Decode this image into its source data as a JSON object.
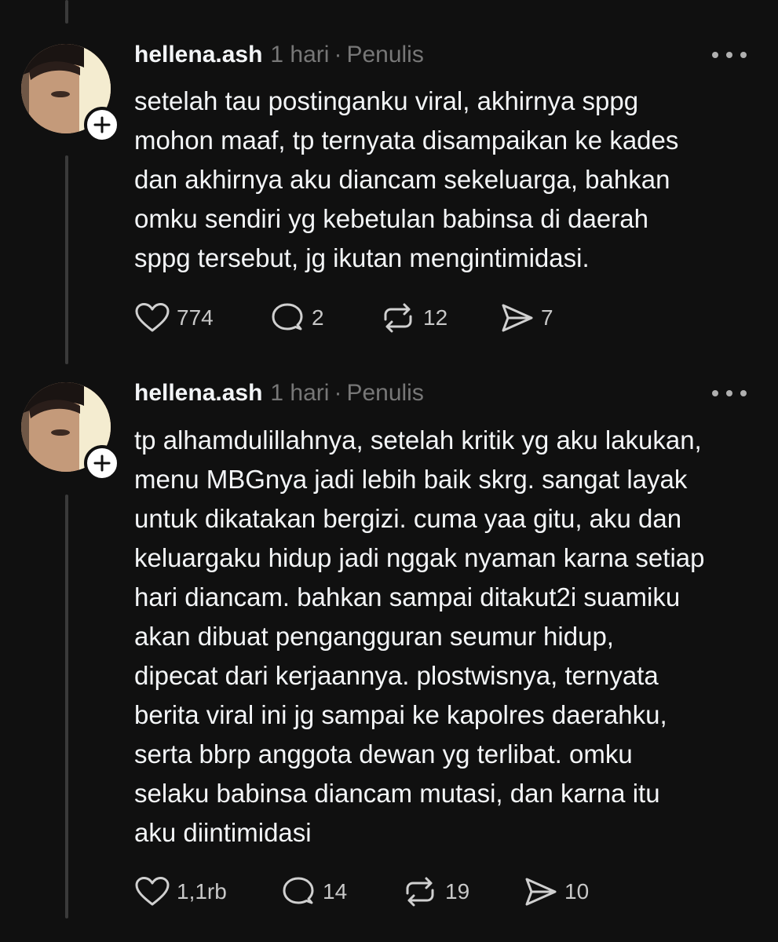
{
  "posts": [
    {
      "username": "hellena.ash",
      "time": "1 hari",
      "separator": "·",
      "role": "Penulis",
      "text": "setelah tau postinganku viral, akhirnya sppg\nmohon maaf, tp ternyata disampaikan ke kades\ndan akhirnya aku diancam sekeluarga, bahkan\nomku sendiri yg kebetulan babinsa di daerah\nsppg tersebut, jg ikutan mengintimidasi.",
      "likes": "774",
      "replies": "2",
      "reposts": "12",
      "shares": "7"
    },
    {
      "username": "hellena.ash",
      "time": "1 hari",
      "separator": "·",
      "role": "Penulis",
      "text": "tp alhamdulillahnya, setelah kritik yg aku lakukan,\nmenu MBGnya jadi lebih baik skrg. sangat layak\nuntuk dikatakan bergizi. cuma yaa gitu, aku dan\nkeluargaku hidup jadi nggak nyaman karna setiap\nhari diancam. bahkan sampai ditakut2i suamiku\nakan dibuat pengangguran seumur hidup,\ndipecat dari kerjaannya. plostwisnya, ternyata\nberita viral ini jg sampai ke kapolres daerahku,\nserta bbrp anggota dewan yg terlibat. omku\nselaku babinsa diancam mutasi, dan karna itu\naku diintimidasi",
      "likes": "1,1rb",
      "replies": "14",
      "reposts": "19",
      "shares": "10"
    }
  ],
  "icons": {
    "like": "heart-icon",
    "reply": "comment-icon",
    "repost": "repost-icon",
    "share": "send-icon",
    "follow": "plus-icon",
    "more": "ellipsis-icon"
  },
  "colors": {
    "background": "#101010",
    "text": "#f3f5f7",
    "muted": "#777777",
    "thread_line": "#3a3a3a"
  }
}
